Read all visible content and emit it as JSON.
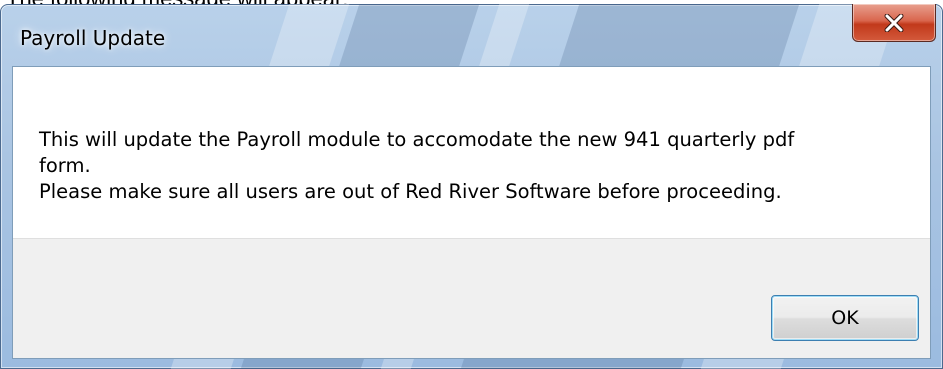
{
  "page": {
    "caption": "The following message will appear:"
  },
  "dialog": {
    "title": "Payroll Update",
    "close_icon": "close-x-icon",
    "message_lines": [
      "This will update the Payroll module to accomodate the new 941 quarterly pdf",
      "form.",
      "Please make sure all users are out of Red River Software before proceeding."
    ],
    "ok_label": "OK"
  },
  "colors": {
    "title_bar": "#a9c4e2",
    "close_button": "#c2391b",
    "button_area": "#f0f0f0",
    "ok_border": "#3c7fb1"
  }
}
